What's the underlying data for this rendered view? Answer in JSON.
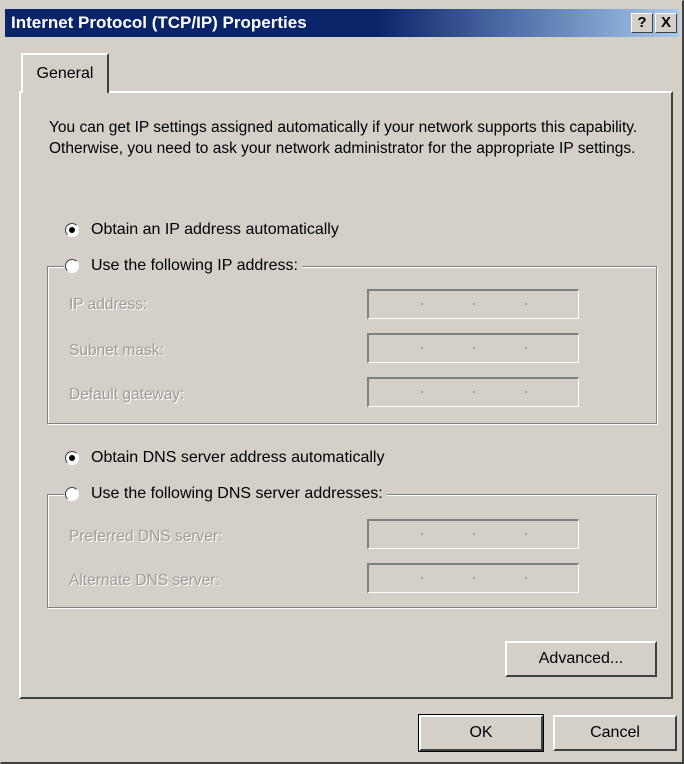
{
  "window": {
    "title": "Internet Protocol (TCP/IP) Properties",
    "help_button": "?",
    "close_button": "X"
  },
  "tabs": [
    {
      "label": "General",
      "selected": true
    }
  ],
  "general": {
    "intro": "You can get IP settings assigned automatically if your network supports this capability. Otherwise, you need to ask your network administrator for the appropriate IP settings.",
    "ip_auto_label": "Obtain an IP address automatically",
    "ip_auto_selected": true,
    "ip_manual_label": "Use the following IP address:",
    "ip_manual_selected": false,
    "ip_fields": [
      {
        "label": "IP address:",
        "value": "",
        "enabled": false
      },
      {
        "label": "Subnet mask:",
        "value": "",
        "enabled": false
      },
      {
        "label": "Default gateway:",
        "value": "",
        "enabled": false
      }
    ],
    "dns_auto_label": "Obtain DNS server address automatically",
    "dns_auto_selected": true,
    "dns_manual_label": "Use the following DNS server addresses:",
    "dns_manual_selected": false,
    "dns_fields": [
      {
        "label": "Preferred DNS server:",
        "value": "",
        "enabled": false
      },
      {
        "label": "Alternate DNS server:",
        "value": "",
        "enabled": false
      }
    ],
    "advanced_button": "Advanced..."
  },
  "footer": {
    "ok_button": "OK",
    "cancel_button": "Cancel"
  },
  "colors": {
    "titlebar_start": "#0a246a",
    "titlebar_end": "#a6caf0",
    "dialog_face": "#d4d0c8",
    "disabled_text": "#a09c94"
  }
}
